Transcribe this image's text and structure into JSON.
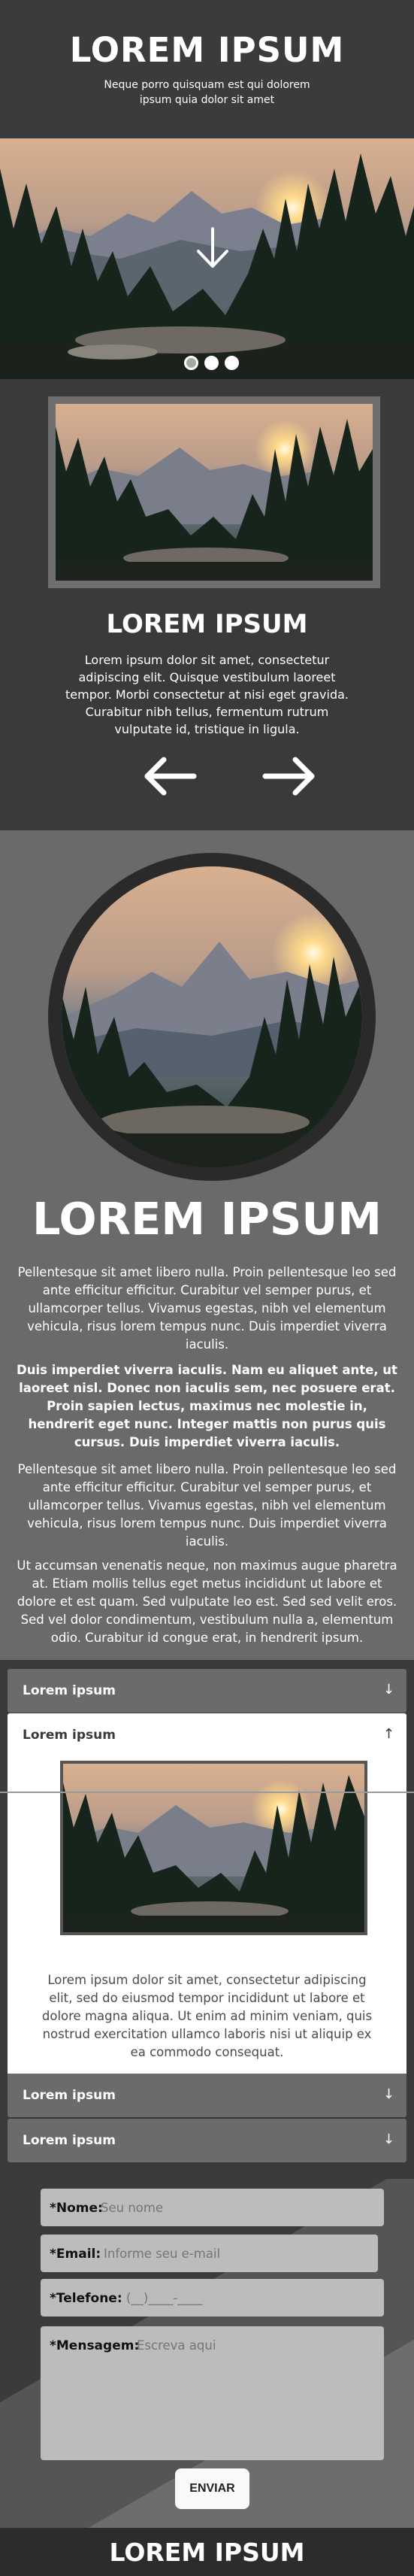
{
  "hero": {
    "title": "LOREM IPSUM",
    "subtitle": "Neque porro quisquam est qui dolorem ipsum quia dolor sit amet",
    "image_icon": "down-arrow-icon",
    "slides": 3,
    "active_slide": 1
  },
  "slider": {
    "title": "LOREM IPSUM",
    "text": "Lorem ipsum dolor sit amet, consectetur adipiscing elit. Quisque vestibulum laoreet tempor. Morbi consectetur at nisi eget gravida. Curabitur nibh tellus, fermentum rutrum vulputate id, tristique in ligula.",
    "prev_icon": "arrow-left-icon",
    "next_icon": "arrow-right-icon"
  },
  "content": {
    "title": "LOREM IPSUM",
    "paragraphs": [
      "Pellentesque sit amet libero nulla. Proin pellentesque leo sed ante efficitur efficitur. Curabitur vel semper purus, et ullamcorper tellus. Vivamus egestas, nibh vel elementum vehicula, risus lorem tempus nunc. Duis imperdiet viverra iaculis.",
      "Duis imperdiet viverra iaculis. Nam eu aliquet ante, ut laoreet nisl. Donec non iaculis sem, nec posuere erat. Proin sapien lectus, maximus nec molestie in, hendrerit eget nunc. Integer mattis non purus quis cursus. Duis imperdiet viverra iaculis.",
      "Pellentesque sit amet libero nulla. Proin pellentesque leo sed ante efficitur efficitur. Curabitur vel semper purus, et ullamcorper tellus. Vivamus egestas, nibh vel elementum vehicula, risus lorem tempus nunc. Duis imperdiet viverra iaculis.",
      "Ut accumsan venenatis neque, non maximus augue pharetra at. Etiam mollis tellus eget metus incididunt ut labore et dolore et est quam. Sed vulputate leo est. Sed sed velit eros. Sed vel dolor condimentum, vestibulum nulla a, elementum odio. Curabitur id congue erat, in hendrerit ipsum."
    ]
  },
  "accordion": {
    "items": [
      {
        "label": "Lorem ipsum",
        "icon": "↓"
      },
      {
        "label": "Lorem ipsum",
        "icon": "↑"
      },
      {
        "label": "Lorem ipsum",
        "icon": "↓"
      },
      {
        "label": "Lorem ipsum",
        "icon": "↓"
      }
    ],
    "open_text": "Lorem ipsum dolor sit amet, consectetur adipiscing elit, sed do eiusmod tempor incididunt ut labore et dolore magna aliqua. Ut enim ad minim veniam, quis nostrud exercitation ullamco laboris nisi ut aliquip ex ea commodo consequat."
  },
  "form": {
    "name_label": "*Nome:",
    "name_placeholder": "Seu nome",
    "email_label": "*Email:",
    "email_placeholder": "Informe seu e-mail",
    "phone_label": "*Telefone:",
    "phone_placeholder": "(__)____-____",
    "message_label": "*Mensagem:",
    "message_placeholder": "Escreva aqui",
    "submit_label": "ENVIAR"
  },
  "footer": {
    "title": "LOREM IPSUM"
  }
}
